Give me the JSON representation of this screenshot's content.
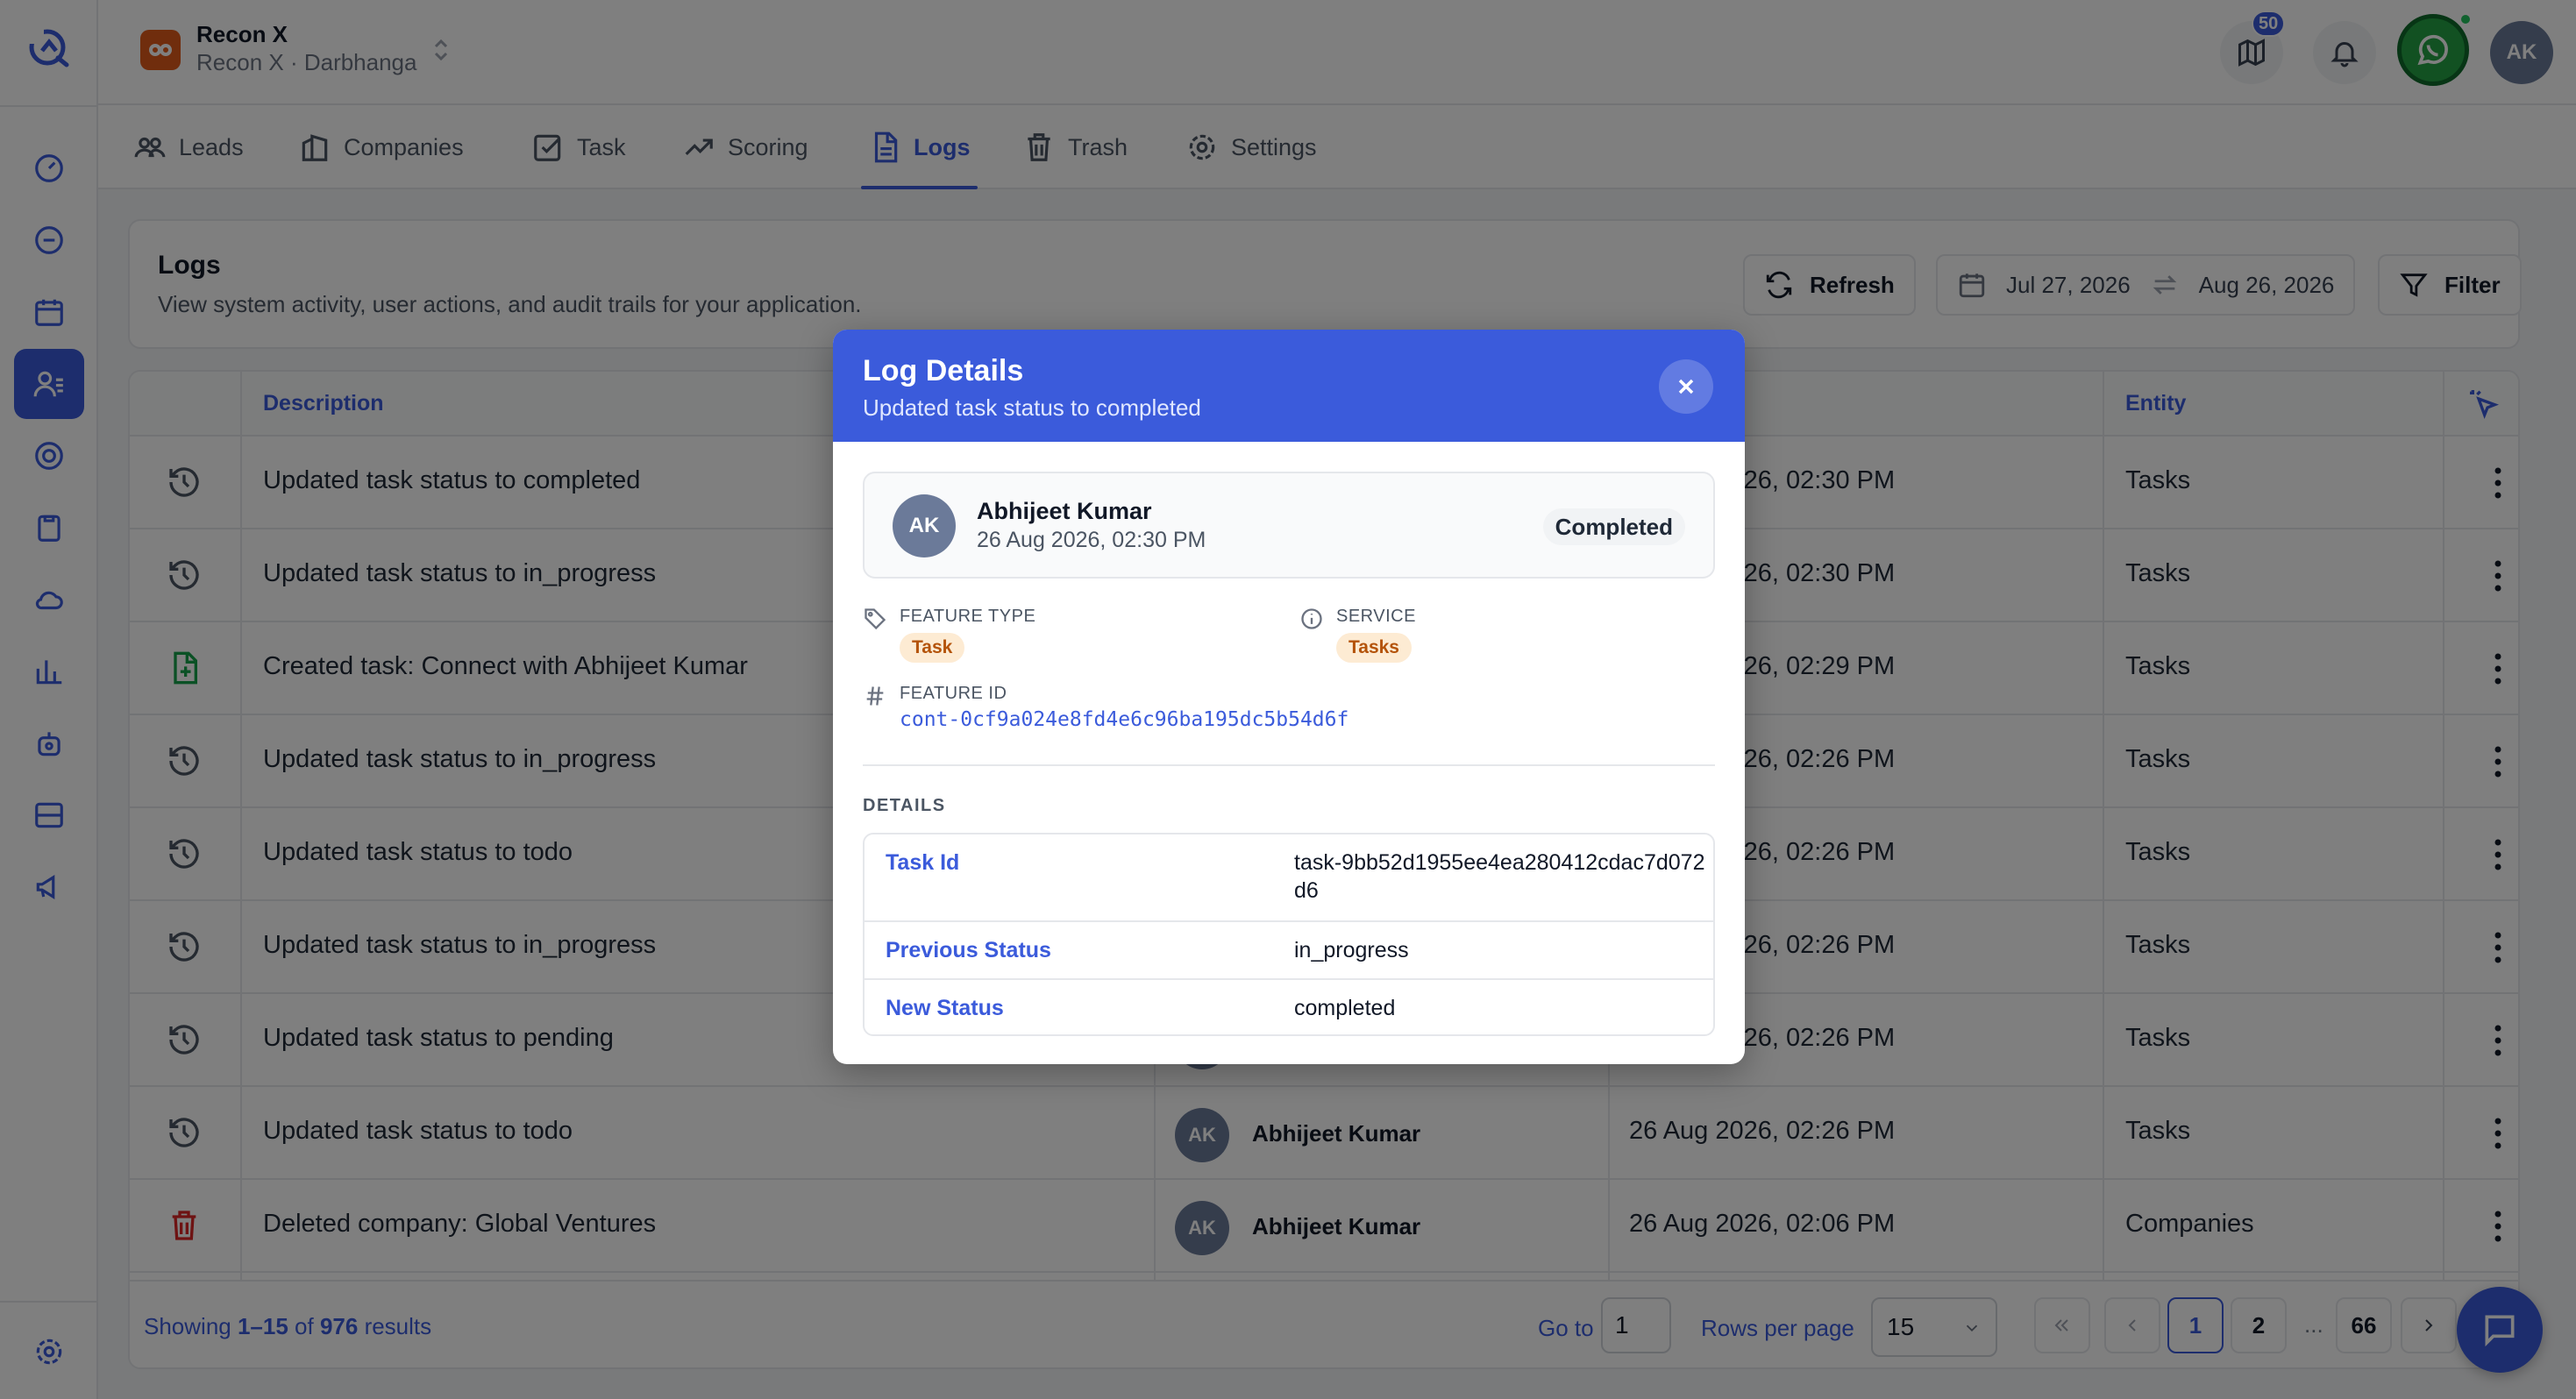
{
  "app": {
    "org_name": "Recon X",
    "org_sub": "Recon X · Darbhanga",
    "notification_count": "50",
    "user_initials": "AK"
  },
  "tabs": [
    {
      "label": "Leads",
      "icon": "users-icon"
    },
    {
      "label": "Companies",
      "icon": "building-icon"
    },
    {
      "label": "Task",
      "icon": "checkbox-icon"
    },
    {
      "label": "Scoring",
      "icon": "trending-up-icon"
    },
    {
      "label": "Logs",
      "icon": "file-text-icon",
      "active": true
    },
    {
      "label": "Trash",
      "icon": "trash-icon"
    },
    {
      "label": "Settings",
      "icon": "gear-icon"
    }
  ],
  "page": {
    "title": "Logs",
    "subtitle": "View system activity, user actions, and audit trails for your application.",
    "refresh_label": "Refresh",
    "date_from": "Jul 27, 2026",
    "date_to": "Aug 26, 2026",
    "filter_label": "Filter"
  },
  "table": {
    "headers": {
      "description": "Description",
      "entity": "Entity"
    },
    "rows": [
      {
        "icon": "history-icon",
        "description": "Updated task status to completed",
        "user_initials": "",
        "user": "",
        "time": "26 Aug 2026, 02:30 PM",
        "entity": "Tasks"
      },
      {
        "icon": "history-icon",
        "description": "Updated task status to in_progress",
        "user_initials": "",
        "user": "",
        "time": "26 Aug 2026, 02:30 PM",
        "entity": "Tasks"
      },
      {
        "icon": "file-plus-icon",
        "description": "Created task: Connect with Abhijeet Kumar",
        "user_initials": "",
        "user": "",
        "time": "26 Aug 2026, 02:29 PM",
        "entity": "Tasks"
      },
      {
        "icon": "history-icon",
        "description": "Updated task status to in_progress",
        "user_initials": "",
        "user": "",
        "time": "26 Aug 2026, 02:26 PM",
        "entity": "Tasks"
      },
      {
        "icon": "history-icon",
        "description": "Updated task status to todo",
        "user_initials": "",
        "user": "",
        "time": "26 Aug 2026, 02:26 PM",
        "entity": "Tasks"
      },
      {
        "icon": "history-icon",
        "description": "Updated task status to in_progress",
        "user_initials": "",
        "user": "",
        "time": "26 Aug 2026, 02:26 PM",
        "entity": "Tasks"
      },
      {
        "icon": "history-icon",
        "description": "Updated task status to pending",
        "user_initials": "AK",
        "user": "",
        "time": "26 Aug 2026, 02:26 PM",
        "entity": "Tasks"
      },
      {
        "icon": "history-icon",
        "description": "Updated task status to todo",
        "user_initials": "AK",
        "user": "Abhijeet Kumar",
        "time": "26 Aug 2026, 02:26 PM",
        "entity": "Tasks"
      },
      {
        "icon": "trash-icon",
        "description": "Deleted company: Global Ventures",
        "user_initials": "AK",
        "user": "Abhijeet Kumar",
        "time": "26 Aug 2026, 02:06 PM",
        "entity": "Companies"
      }
    ]
  },
  "footer": {
    "showing_prefix": "Showing ",
    "showing_range": "1–15",
    "showing_of": " of ",
    "showing_total": "976",
    "showing_suffix": " results",
    "goto_label": "Go to",
    "goto_value": "1",
    "rpp_label": "Rows per page",
    "rpp_value": "15",
    "pages": [
      "1",
      "2",
      "...",
      "66"
    ]
  },
  "modal": {
    "title": "Log Details",
    "subtitle": "Updated task status to completed",
    "user_initials": "AK",
    "user_name": "Abhijeet Kumar",
    "timestamp": "26 Aug 2026, 02:30 PM",
    "status": "Completed",
    "feature_type_label": "FEATURE TYPE",
    "feature_type": "Task",
    "service_label": "SERVICE",
    "service": "Tasks",
    "feature_id_label": "FEATURE ID",
    "feature_id": "cont-0cf9a024e8fd4e6c96ba195dc5b54d6f",
    "details_label": "DETAILS",
    "details": [
      {
        "key": "Task Id",
        "value": "task-9bb52d1955ee4ea280412cdac7d072d6"
      },
      {
        "key": "Previous Status",
        "value": "in_progress"
      },
      {
        "key": "New Status",
        "value": "completed"
      }
    ]
  },
  "colors": {
    "accent": "#3b5bdb",
    "whatsapp": "#25a244",
    "chip_bg": "#fdebd3",
    "chip_text": "#b45309",
    "delete_red": "#dc2626",
    "create_green": "#16a34a"
  }
}
